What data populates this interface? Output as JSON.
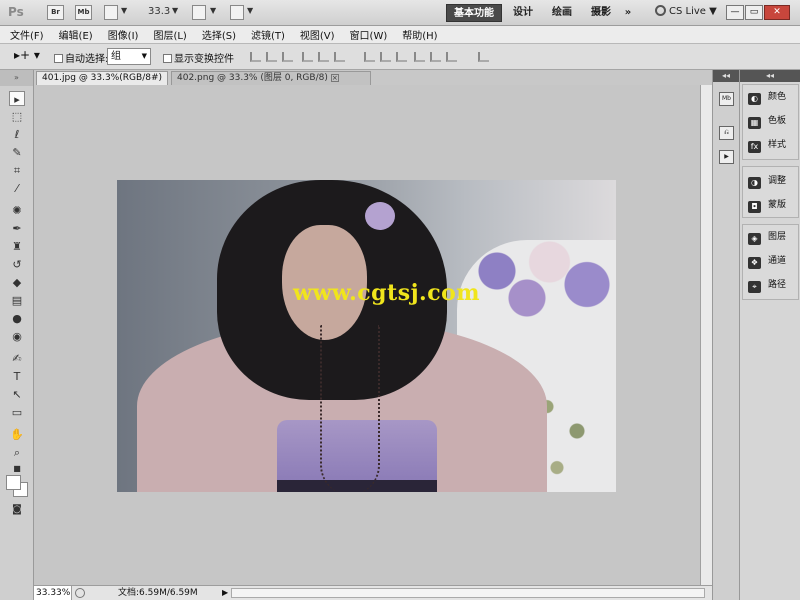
{
  "app": {
    "logo": "Ps",
    "bridge": "Br",
    "minibridge": "Mb",
    "zoom": "33.3",
    "workspaces": [
      "基本功能",
      "设计",
      "绘画",
      "摄影"
    ],
    "more": "»",
    "cslive": "CS Live",
    "window_buttons": [
      "—",
      "▭",
      "✕"
    ]
  },
  "menu": [
    "文件(F)",
    "编辑(E)",
    "图像(I)",
    "图层(L)",
    "选择(S)",
    "滤镜(T)",
    "视图(V)",
    "窗口(W)",
    "帮助(H)"
  ],
  "options": {
    "auto_select_label": "自动选择:",
    "auto_select_value": "组",
    "show_transform_label": "显示变换控件"
  },
  "tabs": [
    {
      "label": "401.jpg @ 33.3%(RGB/8#)",
      "close": "×"
    },
    {
      "label": "402.png @ 33.3% (图层 0, RGB/8)",
      "close": "×"
    }
  ],
  "toolbar": {
    "collapse": "»",
    "tools": [
      "move",
      "marquee",
      "lasso",
      "quick-select",
      "crop",
      "eyedropper",
      "healing",
      "brush",
      "stamp",
      "history-brush",
      "eraser",
      "gradient",
      "blur",
      "dodge",
      "pen",
      "type",
      "path-select",
      "shape",
      "hand",
      "zoom"
    ]
  },
  "canvas": {
    "watermark": "www.cgtsj.com"
  },
  "status": {
    "zoom": "33.33%",
    "doc": "文档:6.59M/6.59M"
  },
  "panels": {
    "collapse": "◂◂",
    "groups": [
      {
        "items": [
          {
            "icon": "palette-icon",
            "label": "颜色"
          },
          {
            "icon": "swatches-icon",
            "label": "色板"
          },
          {
            "icon": "styles-icon",
            "label": "样式"
          }
        ]
      },
      {
        "items": [
          {
            "icon": "adjustments-icon",
            "label": "调整"
          },
          {
            "icon": "mask-icon",
            "label": "蒙版"
          }
        ]
      },
      {
        "items": [
          {
            "icon": "layers-icon",
            "label": "图层"
          },
          {
            "icon": "channels-icon",
            "label": "通道"
          },
          {
            "icon": "paths-icon",
            "label": "路径"
          }
        ]
      }
    ]
  },
  "colors": {
    "workspace_active_bg": "#4a4a4a",
    "canvas_bg": "#c6c6c6",
    "watermark": "#f0e51c",
    "close_button": "#c8463c"
  }
}
